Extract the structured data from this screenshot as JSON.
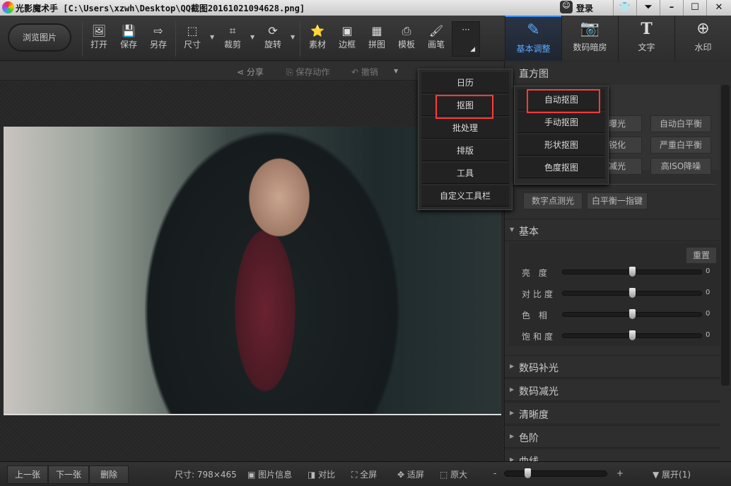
{
  "window": {
    "app_name": "光影魔术手",
    "file_path": "[C:\\Users\\xzwh\\Desktop\\QQ截图20161021094628.png]",
    "login": "登录",
    "title_full": "光影魔术手 [C:\\Users\\xzwh\\Desktop\\QQ截图20161021094628.png]"
  },
  "toolbar": {
    "browse": "浏览图片",
    "tools": [
      "打开",
      "保存",
      "另存",
      "尺寸",
      "裁剪",
      "旋转",
      "素材",
      "边框",
      "拼图",
      "模板",
      "画笔"
    ],
    "more": "···"
  },
  "right_tabs": [
    {
      "label": "基本调整",
      "active": true
    },
    {
      "label": "数码暗房"
    },
    {
      "label": "文字"
    },
    {
      "label": "水印"
    }
  ],
  "subbar": {
    "share": "分享",
    "save_action": "保存动作",
    "undo": "撤销"
  },
  "more_menu": {
    "items": [
      "日历",
      "抠图",
      "批处理",
      "排版",
      "工具",
      "自定义工具栏"
    ],
    "highlighted": "抠图"
  },
  "cutout_menu": {
    "items": [
      "自动抠图",
      "手动抠图",
      "形状抠图",
      "色度抠图"
    ],
    "highlighted": "自动抠图"
  },
  "panel": {
    "histogram": "直方图",
    "quick_buttons": [
      "动曝光",
      "自动白平衡",
      "建锐化",
      "严重白平衡",
      "建减光",
      "高ISO降噪",
      "数字点测光",
      "白平衡一指键"
    ],
    "basic": {
      "title": "基本",
      "reset": "重置",
      "sliders": [
        {
          "label": "亮 度",
          "value": "0"
        },
        {
          "label": "对比度",
          "value": "0"
        },
        {
          "label": "色 相",
          "value": "0"
        },
        {
          "label": "饱和度",
          "value": "0"
        }
      ]
    },
    "sections": [
      "数码补光",
      "数码减光",
      "清晰度",
      "色阶",
      "曲线"
    ]
  },
  "bottom": {
    "prev": "上一张",
    "next": "下一张",
    "delete": "删除",
    "size": "尺寸: 798×465",
    "info": "图片信息",
    "compare": "对比",
    "fullscreen": "全屏",
    "fit": "适屏",
    "original": "原大",
    "minus": "-",
    "plus": "+",
    "expand": "展开(1)",
    "zoom_level": 0.2
  },
  "colors": {
    "accent": "#3c8ef0",
    "highlight_box": "#ff3b3b"
  }
}
